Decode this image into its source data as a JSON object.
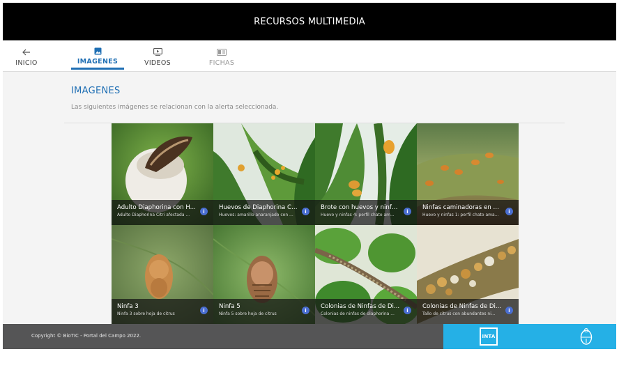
{
  "header": {
    "title": "RECURSOS MULTIMEDIA"
  },
  "tabs": [
    {
      "label": "INICIO",
      "icon": "back-arrow-icon"
    },
    {
      "label": "IMAGENES",
      "icon": "image-icon"
    },
    {
      "label": "VIDEOS",
      "icon": "video-icon"
    },
    {
      "label": "FICHAS",
      "icon": "document-icon"
    }
  ],
  "section": {
    "title": "IMAGENES",
    "subtitle": "Las siguientes imágenes se relacionan con la alerta seleccionada."
  },
  "images": [
    {
      "title": "Adulto Diaphorina con H...",
      "desc": "Adulto Diaphorina Citri afectada ..."
    },
    {
      "title": "Huevos de Diaphorina Ci...",
      "desc": "Huevos: amarillo anaranjado con ..."
    },
    {
      "title": "Brote con huevos y ninfa...",
      "desc": "Huevo y ninfas 4: perfil chato am..."
    },
    {
      "title": "Ninfas caminadoras en b...",
      "desc": "Huevo y ninfas 1: perfil chato ama..."
    },
    {
      "title": "Ninfa 3",
      "desc": "Ninfa 3 sobre hoja de citrus"
    },
    {
      "title": "Ninfa 5",
      "desc": "Ninfa 5 sobre hoja de citrus"
    },
    {
      "title": "Colonias de Ninfas de Di...",
      "desc": "Colonias de ninfas de diaphorina ..."
    },
    {
      "title": "Colonias de Ninfas de Di...",
      "desc": "Tallo de citrus con abundantes ni..."
    }
  ],
  "footer": {
    "copyright": "Copyright © BioTIC - Portal del Campo 2022.",
    "logo_text": "INTA"
  },
  "colors": {
    "accent": "#1f6fb4",
    "footer_blue": "#25b0e6",
    "info_badge": "#4a6ed1"
  }
}
